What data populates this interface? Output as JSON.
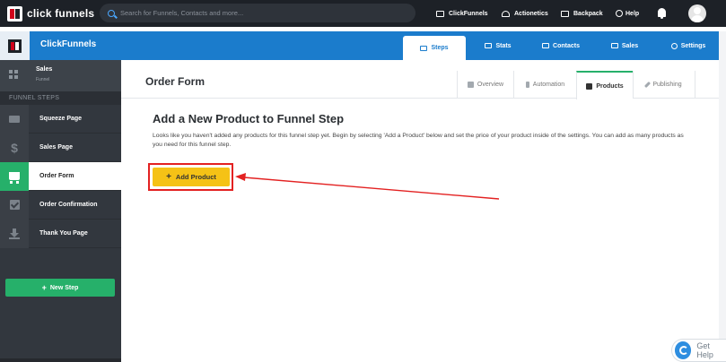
{
  "topbar": {
    "logo_text": "click funnels",
    "search_placeholder": "Search for Funnels, Contacts and more...",
    "nav": [
      {
        "label": "ClickFunnels",
        "icon": "funnel-icon"
      },
      {
        "label": "Actionetics",
        "icon": "headset-icon"
      },
      {
        "label": "Backpack",
        "icon": "backpack-icon"
      },
      {
        "label": "Help",
        "icon": "help-circle-icon"
      }
    ],
    "notification_icon": "bell-icon",
    "avatar_icon": "user-avatar-icon"
  },
  "header": {
    "app_title": "ClickFunnels",
    "tabs": [
      {
        "label": "Steps",
        "icon": "list-icon",
        "active": true
      },
      {
        "label": "Stats",
        "icon": "bar-chart-icon",
        "active": false
      },
      {
        "label": "Contacts",
        "icon": "users-icon",
        "active": false
      },
      {
        "label": "Sales",
        "icon": "money-icon",
        "active": false
      },
      {
        "label": "Settings",
        "icon": "gear-icon",
        "active": false
      }
    ]
  },
  "sidebar": {
    "funnel_name": "Sales",
    "funnel_type": "Funnel",
    "section_title": "FUNNEL STEPS",
    "steps": [
      {
        "label": "Squeeze Page",
        "icon": "envelope-icon",
        "active": false
      },
      {
        "label": "Sales Page",
        "icon": "dollar-icon",
        "active": false
      },
      {
        "label": "Order Form",
        "icon": "cart-icon",
        "active": true
      },
      {
        "label": "Order Confirmation",
        "icon": "checkbox-icon",
        "active": false
      },
      {
        "label": "Thank You Page",
        "icon": "download-icon",
        "active": false
      }
    ],
    "new_step_label": "New Step"
  },
  "main": {
    "page_title": "Order Form",
    "subtabs": [
      {
        "label": "Overview",
        "icon": "grid-icon",
        "active": false
      },
      {
        "label": "Automation",
        "icon": "bolt-icon",
        "active": false
      },
      {
        "label": "Products",
        "icon": "cart-icon",
        "active": true
      },
      {
        "label": "Publishing",
        "icon": "wrench-icon",
        "active": false
      }
    ],
    "heading": "Add a New Product to Funnel Step",
    "description": "Looks like you haven't added any products for this funnel step yet. Begin by selecting 'Add a Product' below and set the price of your product inside of the settings. You can add as many products as you need for this funnel step.",
    "add_button_label": "Add Product"
  },
  "help_widget": {
    "label": "Get Help"
  },
  "colors": {
    "topbar": "#1d2127",
    "brand_blue": "#1b7ccc",
    "sidebar": "#32373e",
    "active_green": "#26b06a",
    "button_yellow": "#f5c216",
    "annotation_red": "#e32121"
  }
}
